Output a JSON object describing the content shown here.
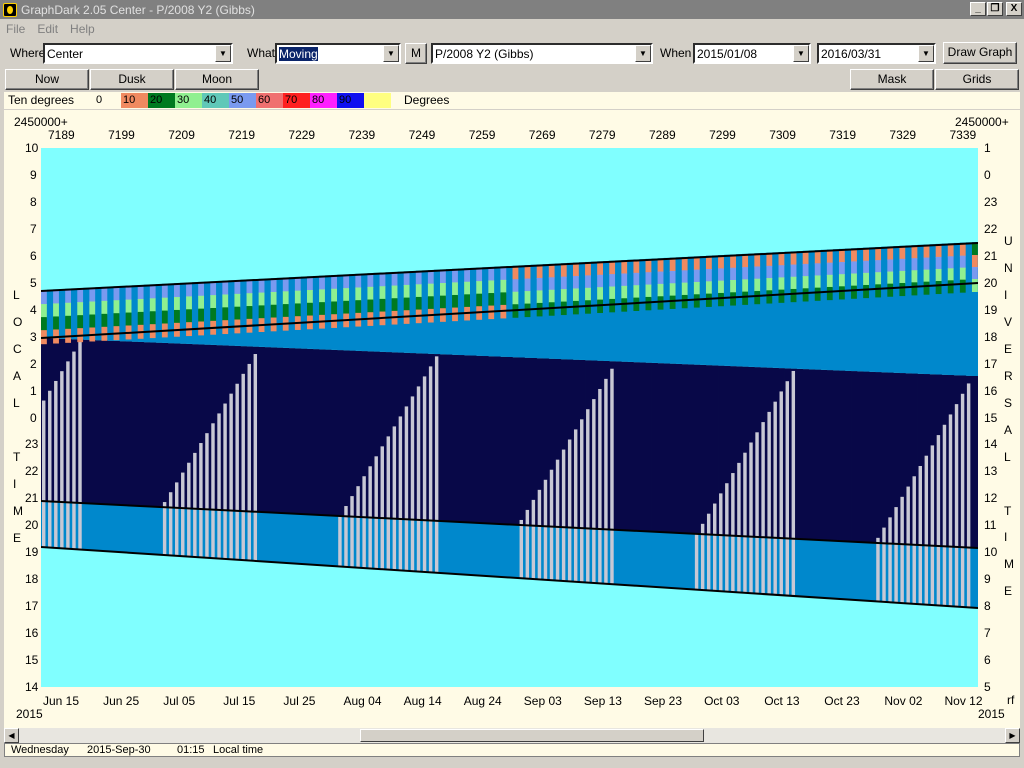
{
  "window": {
    "title": "GraphDark 2.05  Center  -  P/2008 Y2 (Gibbs)",
    "buttons": [
      "_",
      "❐",
      "X"
    ]
  },
  "menu": [
    "File",
    "Edit",
    "Help"
  ],
  "toolbar": {
    "where_label": "Where",
    "where_value": "Center",
    "what_label": "What",
    "what_value": "Moving",
    "m_button": "M",
    "object_value": "P/2008 Y2 (Gibbs)",
    "when_label": "When",
    "start_date": "2015/01/08",
    "end_date": "2016/03/31",
    "draw_button": "Draw Graph"
  },
  "buttons2": {
    "now": "Now",
    "dusk": "Dusk",
    "moon": "Moon",
    "mask": "Mask",
    "grids": "Grids"
  },
  "legend": {
    "title": "Ten degrees",
    "unit": "Degrees",
    "entries": [
      {
        "label": "0",
        "color": "#fffbe6"
      },
      {
        "label": "10",
        "color": "#f08a60"
      },
      {
        "label": "20",
        "color": "#007a20"
      },
      {
        "label": "30",
        "color": "#90f090"
      },
      {
        "label": "40",
        "color": "#60c8b8"
      },
      {
        "label": "50",
        "color": "#7a9af0"
      },
      {
        "label": "60",
        "color": "#f07070"
      },
      {
        "label": "70",
        "color": "#ff2020"
      },
      {
        "label": "80",
        "color": "#ff20ff"
      },
      {
        "label": "90",
        "color": "#1010f0"
      },
      {
        "label": "",
        "color": "#ffff80"
      }
    ]
  },
  "chart_data": {
    "type": "heatmap",
    "top_prefix_left": "2450000+",
    "top_prefix_right": "2450000+",
    "jd_ticks": [
      "7189",
      "7199",
      "7209",
      "7219",
      "7229",
      "7239",
      "7249",
      "7259",
      "7269",
      "7279",
      "7289",
      "7299",
      "7309",
      "7319",
      "7329",
      "7339"
    ],
    "date_ticks": [
      "Jun 15",
      "Jun 25",
      "Jul 05",
      "Jul 15",
      "Jul 25",
      "Aug 04",
      "Aug 14",
      "Aug 24",
      "Sep 03",
      "Sep 13",
      "Sep 23",
      "Oct 03",
      "Oct 13",
      "Oct 23",
      "Nov 02",
      "Nov 12"
    ],
    "year_left": "2015",
    "year_right": "2015",
    "right_corner": "rf",
    "left_axis": [
      "10",
      "9",
      "8",
      "7",
      "6",
      "5",
      "4",
      "3",
      "2",
      "1",
      "0",
      "23",
      "22",
      "21",
      "20",
      "19",
      "18",
      "17",
      "16",
      "15",
      "14"
    ],
    "right_axis": [
      "1",
      "0",
      "23",
      "22",
      "21",
      "20",
      "19",
      "18",
      "17",
      "16",
      "15",
      "14",
      "13",
      "12",
      "11",
      "10",
      "9",
      "8",
      "7",
      "6",
      "5"
    ],
    "left_title": [
      "L",
      "O",
      "C",
      "A",
      "L",
      "",
      "T",
      "I",
      "M",
      "E"
    ],
    "right_title": [
      "U",
      "N",
      "I",
      "V",
      "E",
      "R",
      "S",
      "A",
      "L",
      "",
      "T",
      "I",
      "M",
      "E"
    ],
    "colors": {
      "daylight": "#80ffff",
      "twilight": "#0088cc",
      "night": "#080848",
      "moon": "#c8c8d4",
      "object_line": "#000000"
    }
  },
  "status": {
    "day": "Wednesday",
    "date": "2015-Sep-30",
    "time": "01:15",
    "mode": "Local time"
  }
}
